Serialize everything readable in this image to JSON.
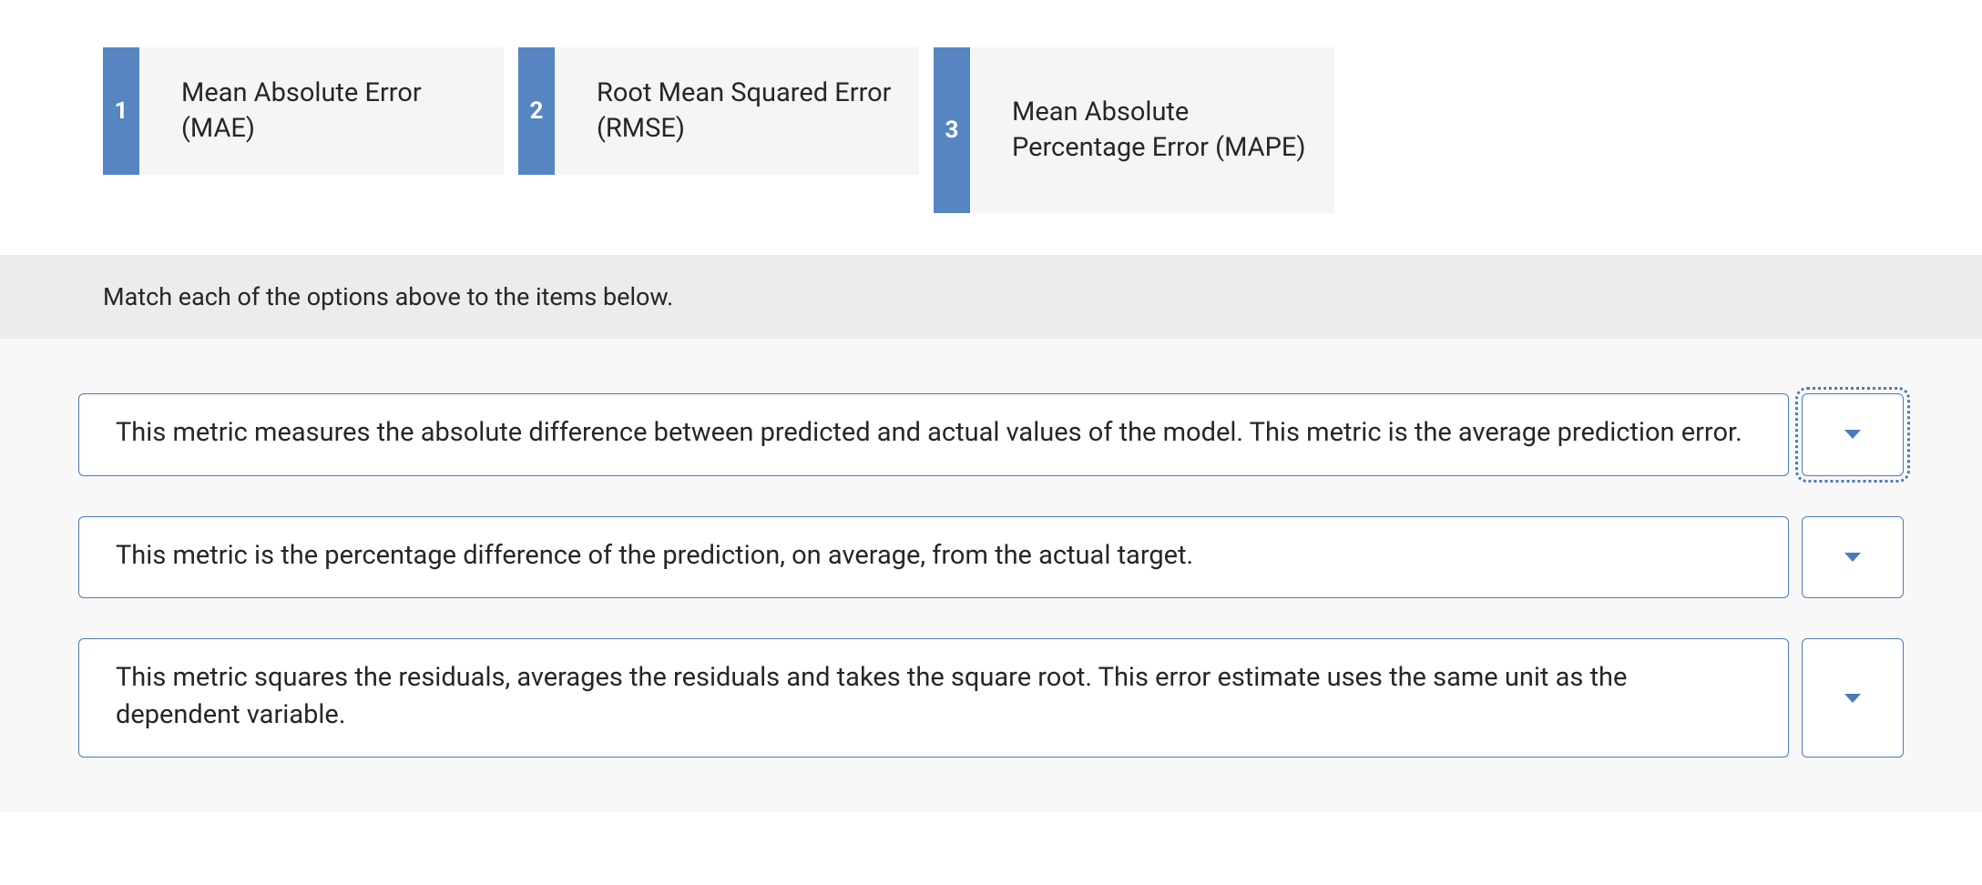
{
  "options": [
    {
      "num": "1",
      "label": "Mean Absolute Error (MAE)"
    },
    {
      "num": "2",
      "label": "Root Mean Squared Error (RMSE)"
    },
    {
      "num": "3",
      "label": "Mean Absolute Percentage Error (MAPE)"
    }
  ],
  "instruction": "Match each of the options above to the items below.",
  "items": [
    {
      "text": "This metric measures the absolute difference between predicted and actual values of the model. This metric is the average prediction error.",
      "focused": true
    },
    {
      "text": "This metric is the percentage difference of the prediction, on average, from the actual target.",
      "focused": false
    },
    {
      "text": "This metric squares the residuals, averages the residuals and takes the square root. This error estimate uses the same unit as the dependent variable.",
      "focused": false
    }
  ]
}
